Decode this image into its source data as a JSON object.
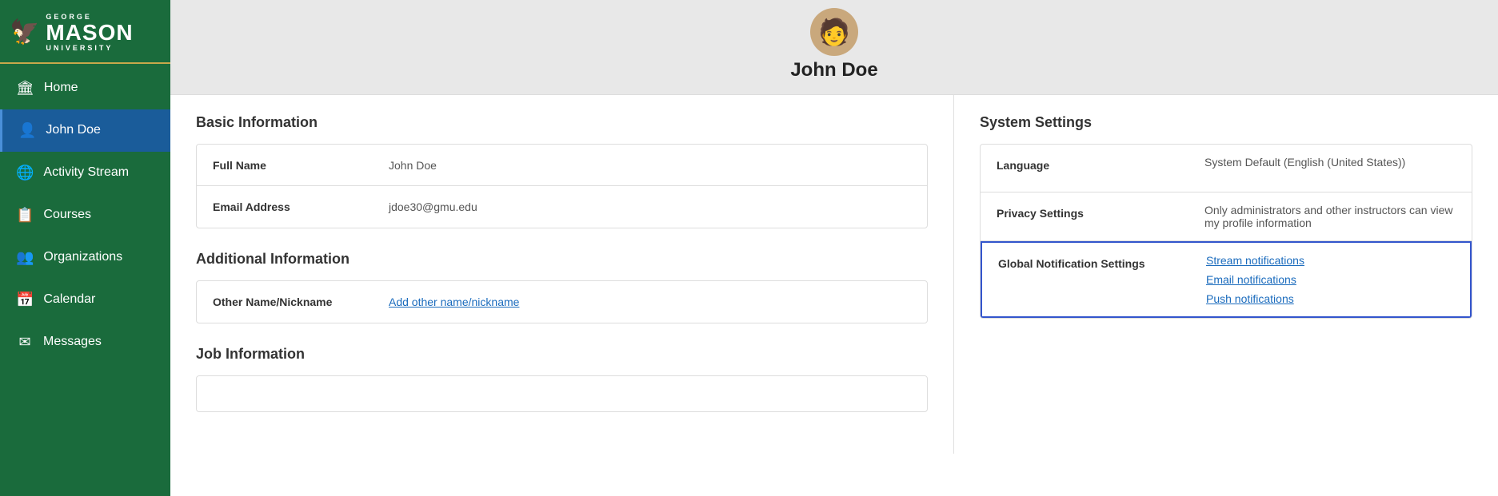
{
  "sidebar": {
    "logo": {
      "line1": "GEORGE",
      "line2": "MASON",
      "line3": "UNIVERSITY"
    },
    "items": [
      {
        "label": "Home",
        "icon": "🏛",
        "id": "home",
        "active": false
      },
      {
        "label": "John Doe",
        "icon": "👤",
        "id": "john-doe",
        "active": true
      },
      {
        "label": "Activity Stream",
        "icon": "🌐",
        "id": "activity-stream",
        "active": false
      },
      {
        "label": "Courses",
        "icon": "📋",
        "id": "courses",
        "active": false
      },
      {
        "label": "Organizations",
        "icon": "👥",
        "id": "organizations",
        "active": false
      },
      {
        "label": "Calendar",
        "icon": "📅",
        "id": "calendar",
        "active": false
      },
      {
        "label": "Messages",
        "icon": "✉",
        "id": "messages",
        "active": false
      }
    ]
  },
  "profile": {
    "name": "John Doe"
  },
  "basic_information": {
    "title": "Basic Information",
    "fields": [
      {
        "label": "Full Name",
        "value": "John Doe",
        "is_link": false
      },
      {
        "label": "Email Address",
        "value": "jdoe30@gmu.edu",
        "is_link": false
      }
    ]
  },
  "additional_information": {
    "title": "Additional Information",
    "fields": [
      {
        "label": "Other Name/Nickname",
        "value": "Add other name/nickname",
        "is_link": true
      }
    ]
  },
  "job_information": {
    "title": "Job Information"
  },
  "system_settings": {
    "title": "System Settings",
    "rows": [
      {
        "label": "Language",
        "value": "System Default (English (United States))",
        "is_links": false
      },
      {
        "label": "Privacy Settings",
        "value": "Only administrators and other instructors can view my profile information",
        "is_links": false
      },
      {
        "label": "Global Notification Settings",
        "value": "",
        "is_links": true,
        "links": [
          "Stream notifications",
          "Email notifications",
          "Push notifications"
        ]
      }
    ]
  }
}
